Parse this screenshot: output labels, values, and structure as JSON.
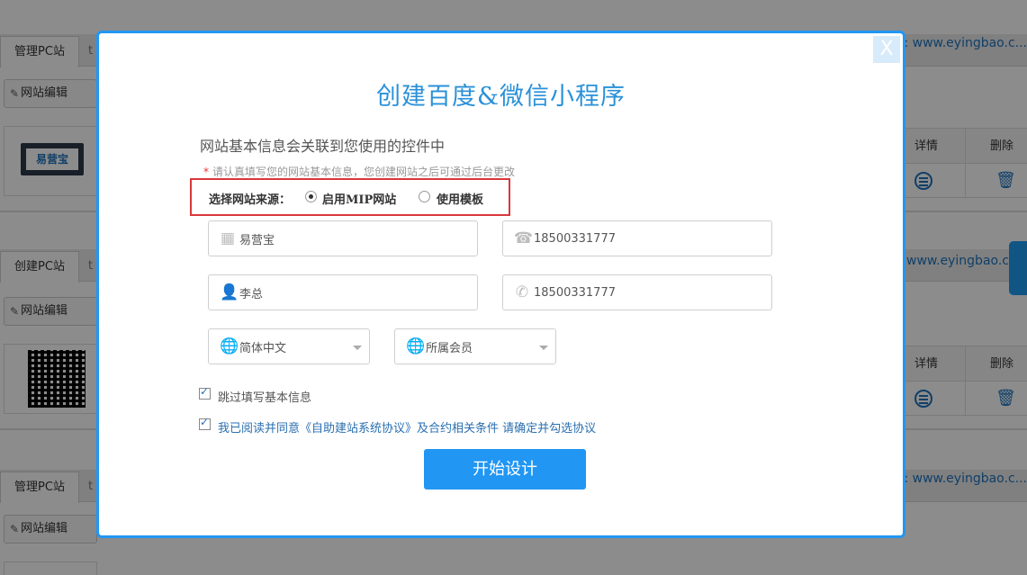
{
  "background": {
    "sections": [
      {
        "tab": "管理PC站",
        "url": ": www.eyingbao.c...",
        "edit": "网站编辑",
        "thumb": "易营宝",
        "head_detail": "详情",
        "head_delete": "删除"
      },
      {
        "tab": "创建PC站",
        "url": ": www.eyingbao.c",
        "edit": "网站编辑",
        "thumb": "QR",
        "head_detail": "详情",
        "head_delete": "删除"
      },
      {
        "tab": "管理PC站",
        "url": ": www.eyingbao.c...",
        "edit": "网站编辑"
      }
    ],
    "second_tab_glyph": "t"
  },
  "modal": {
    "close_label": "X",
    "title": "创建百度&微信小程序",
    "subtitle": "网站基本信息会关联到您使用的控件中",
    "notice_star": "*",
    "notice": "请认真填写您的网站基本信息，您创建网站之后可通过后台更改",
    "source": {
      "label": "选择网站来源：",
      "options": [
        {
          "label": "启用MIP网站",
          "checked": true
        },
        {
          "label": "使用模板",
          "checked": false
        }
      ]
    },
    "fields": {
      "company": {
        "value": "易营宝",
        "icon": "building-icon"
      },
      "phone": {
        "value": "18500331777",
        "icon": "telephone-icon"
      },
      "contact": {
        "value": "李总",
        "icon": "user-icon"
      },
      "mobile": {
        "value": "18500331777",
        "icon": "handset-icon"
      },
      "language": {
        "value": "简体中文",
        "icon": "globe-icon"
      },
      "member": {
        "value": "所属会员",
        "icon": "globe-icon"
      }
    },
    "checkboxes": {
      "skip": {
        "label": "跳过填写基本信息",
        "checked": true
      },
      "agree": {
        "label": "我已阅读并同意《自助建站系统协议》及合约相关条件  请确定并勾选协议",
        "checked": true
      }
    },
    "start_button": "开始设计"
  },
  "colors": {
    "accent": "#2196f3",
    "title": "#2a91d8",
    "highlight_border": "#d9383a"
  }
}
